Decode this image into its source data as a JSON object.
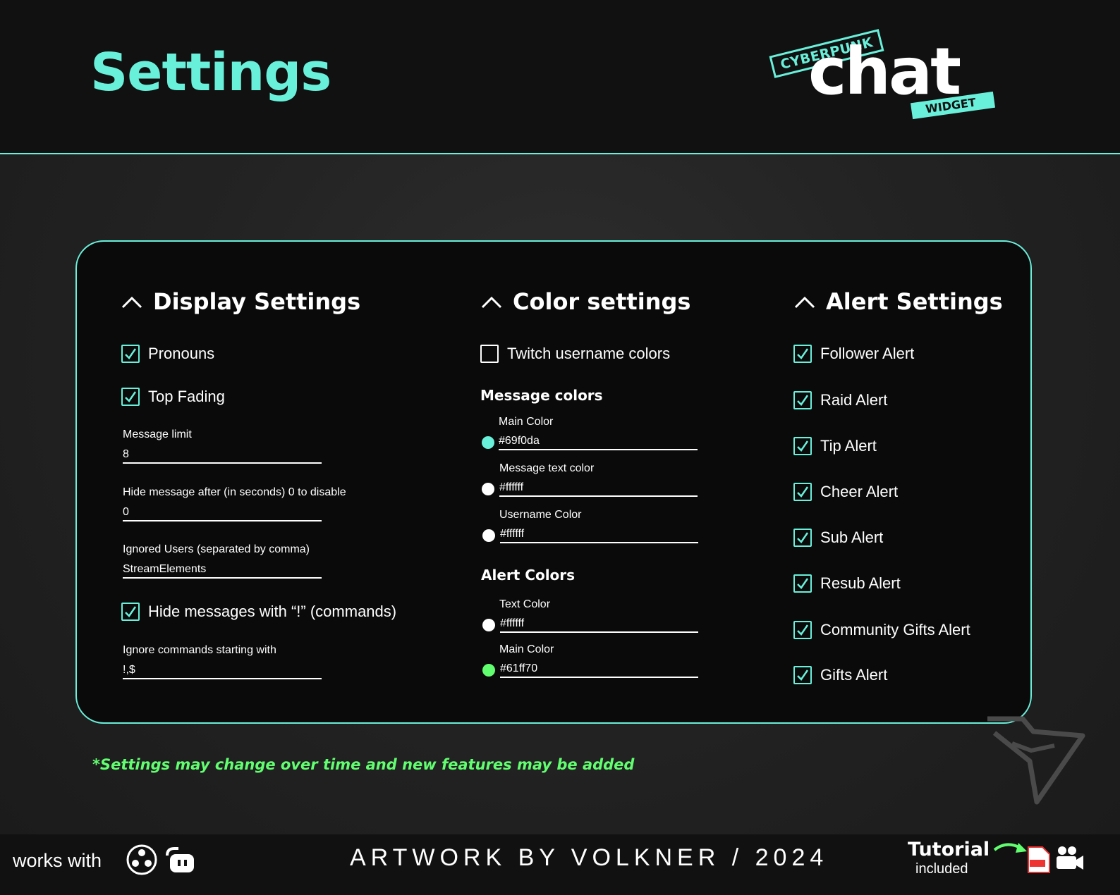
{
  "page_title": "Settings",
  "logo": {
    "tag_top": "CYBERPUNK",
    "word": "chat",
    "tag_bottom": "WIDGET"
  },
  "colors": {
    "accent": "#69f0da",
    "note_green": "#61ff70",
    "panel_bg": "#0a0a0a"
  },
  "display": {
    "title": "Display Settings",
    "pronouns": {
      "label": "Pronouns",
      "checked": true
    },
    "top_fading": {
      "label": "Top Fading",
      "checked": true
    },
    "message_limit": {
      "label": "Message limit",
      "value": "8"
    },
    "hide_after": {
      "label": "Hide message after (in seconds) 0 to disable",
      "value": "0"
    },
    "ignored_users": {
      "label": "Ignored Users (separated by comma)",
      "value": "StreamElements"
    },
    "hide_commands": {
      "label": "Hide messages with “!” (commands)",
      "checked": true
    },
    "ignore_prefix": {
      "label": "Ignore commands starting with",
      "value": "!,$"
    }
  },
  "color": {
    "title": "Color settings",
    "twitch_colors": {
      "label": "Twitch username colors",
      "checked": false
    },
    "message_colors_title": "Message colors",
    "main_color": {
      "label": "Main Color",
      "value": "#69f0da",
      "swatch": "#69f0da"
    },
    "text_color": {
      "label": "Message text color",
      "value": "#ffffff",
      "swatch": "#ffffff"
    },
    "username_color": {
      "label": "Username Color",
      "value": "#ffffff",
      "swatch": "#ffffff"
    },
    "alert_colors_title": "Alert Colors",
    "alert_text_color": {
      "label": "Text Color",
      "value": "#ffffff",
      "swatch": "#ffffff"
    },
    "alert_main_color": {
      "label": "Main Color",
      "value": "#61ff70",
      "swatch": "#61ff70"
    }
  },
  "alerts": {
    "title": "Alert Settings",
    "items": [
      {
        "label": "Follower Alert",
        "checked": true
      },
      {
        "label": "Raid Alert",
        "checked": true
      },
      {
        "label": "Tip Alert",
        "checked": true
      },
      {
        "label": "Cheer Alert",
        "checked": true
      },
      {
        "label": "Sub Alert",
        "checked": true
      },
      {
        "label": "Resub Alert",
        "checked": true
      },
      {
        "label": "Community Gifts Alert",
        "checked": true
      },
      {
        "label": "Gifts Alert",
        "checked": true
      }
    ]
  },
  "footnote": "*Settings may change over time and new features may be added",
  "footer": {
    "works_with": "works with",
    "credit": "ARTWORK BY VOLKNER / 2024",
    "tutorial_title": "Tutorial",
    "tutorial_sub": "included",
    "icons": [
      "obs-icon",
      "streamlabs-icon",
      "arrow-icon",
      "pdf-icon",
      "video-icon"
    ]
  }
}
